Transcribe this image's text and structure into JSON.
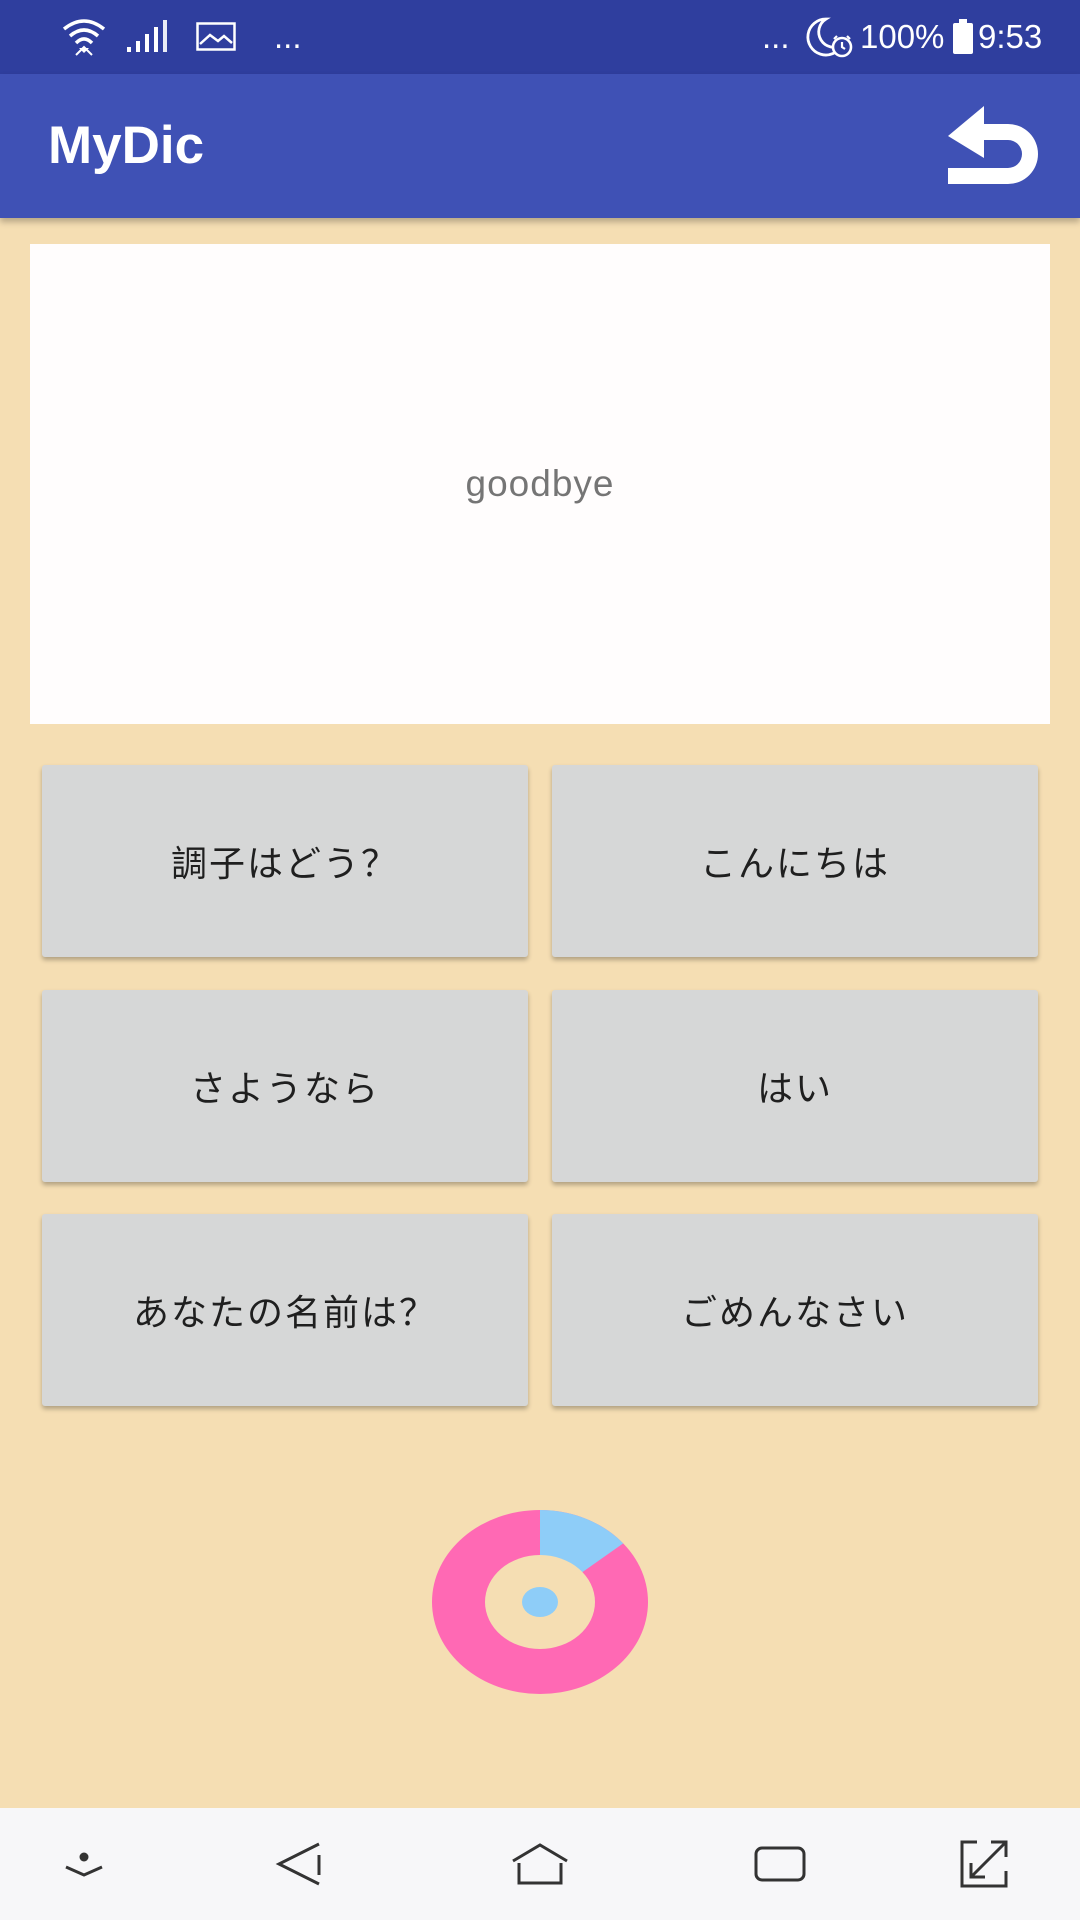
{
  "status_bar": {
    "left_ellipsis": "...",
    "right_ellipsis": "...",
    "battery_percent": "100%",
    "time": "9:53",
    "icons": [
      "wifi-icon",
      "signal-icon",
      "image-notification-icon",
      "moon-alarm-icon",
      "battery-icon"
    ]
  },
  "app_bar": {
    "title": "MyDic",
    "back_icon": "return-arrow-icon"
  },
  "question": {
    "word": "goodbye"
  },
  "choices": [
    "調子はどう？",
    "こんにちは",
    "さようなら",
    "はい",
    "あなたの名前は？",
    "ごめんなさい"
  ],
  "progress": {
    "correct_fraction": 0.14,
    "colors": {
      "main": "#ff69b4",
      "accent": "#8ecdf8",
      "hole": "#f5deb3"
    }
  },
  "nav_bar": {
    "icons": [
      "hide-keyboard-icon",
      "back-triangle-icon",
      "home-icon",
      "recent-apps-icon",
      "expand-icon"
    ]
  },
  "colors": {
    "status_bar": "#2f3e9e",
    "app_bar": "#3f51b5",
    "background": "#f5deb3",
    "card": "#fffdfd",
    "choice_button": "#d6d7d7"
  }
}
